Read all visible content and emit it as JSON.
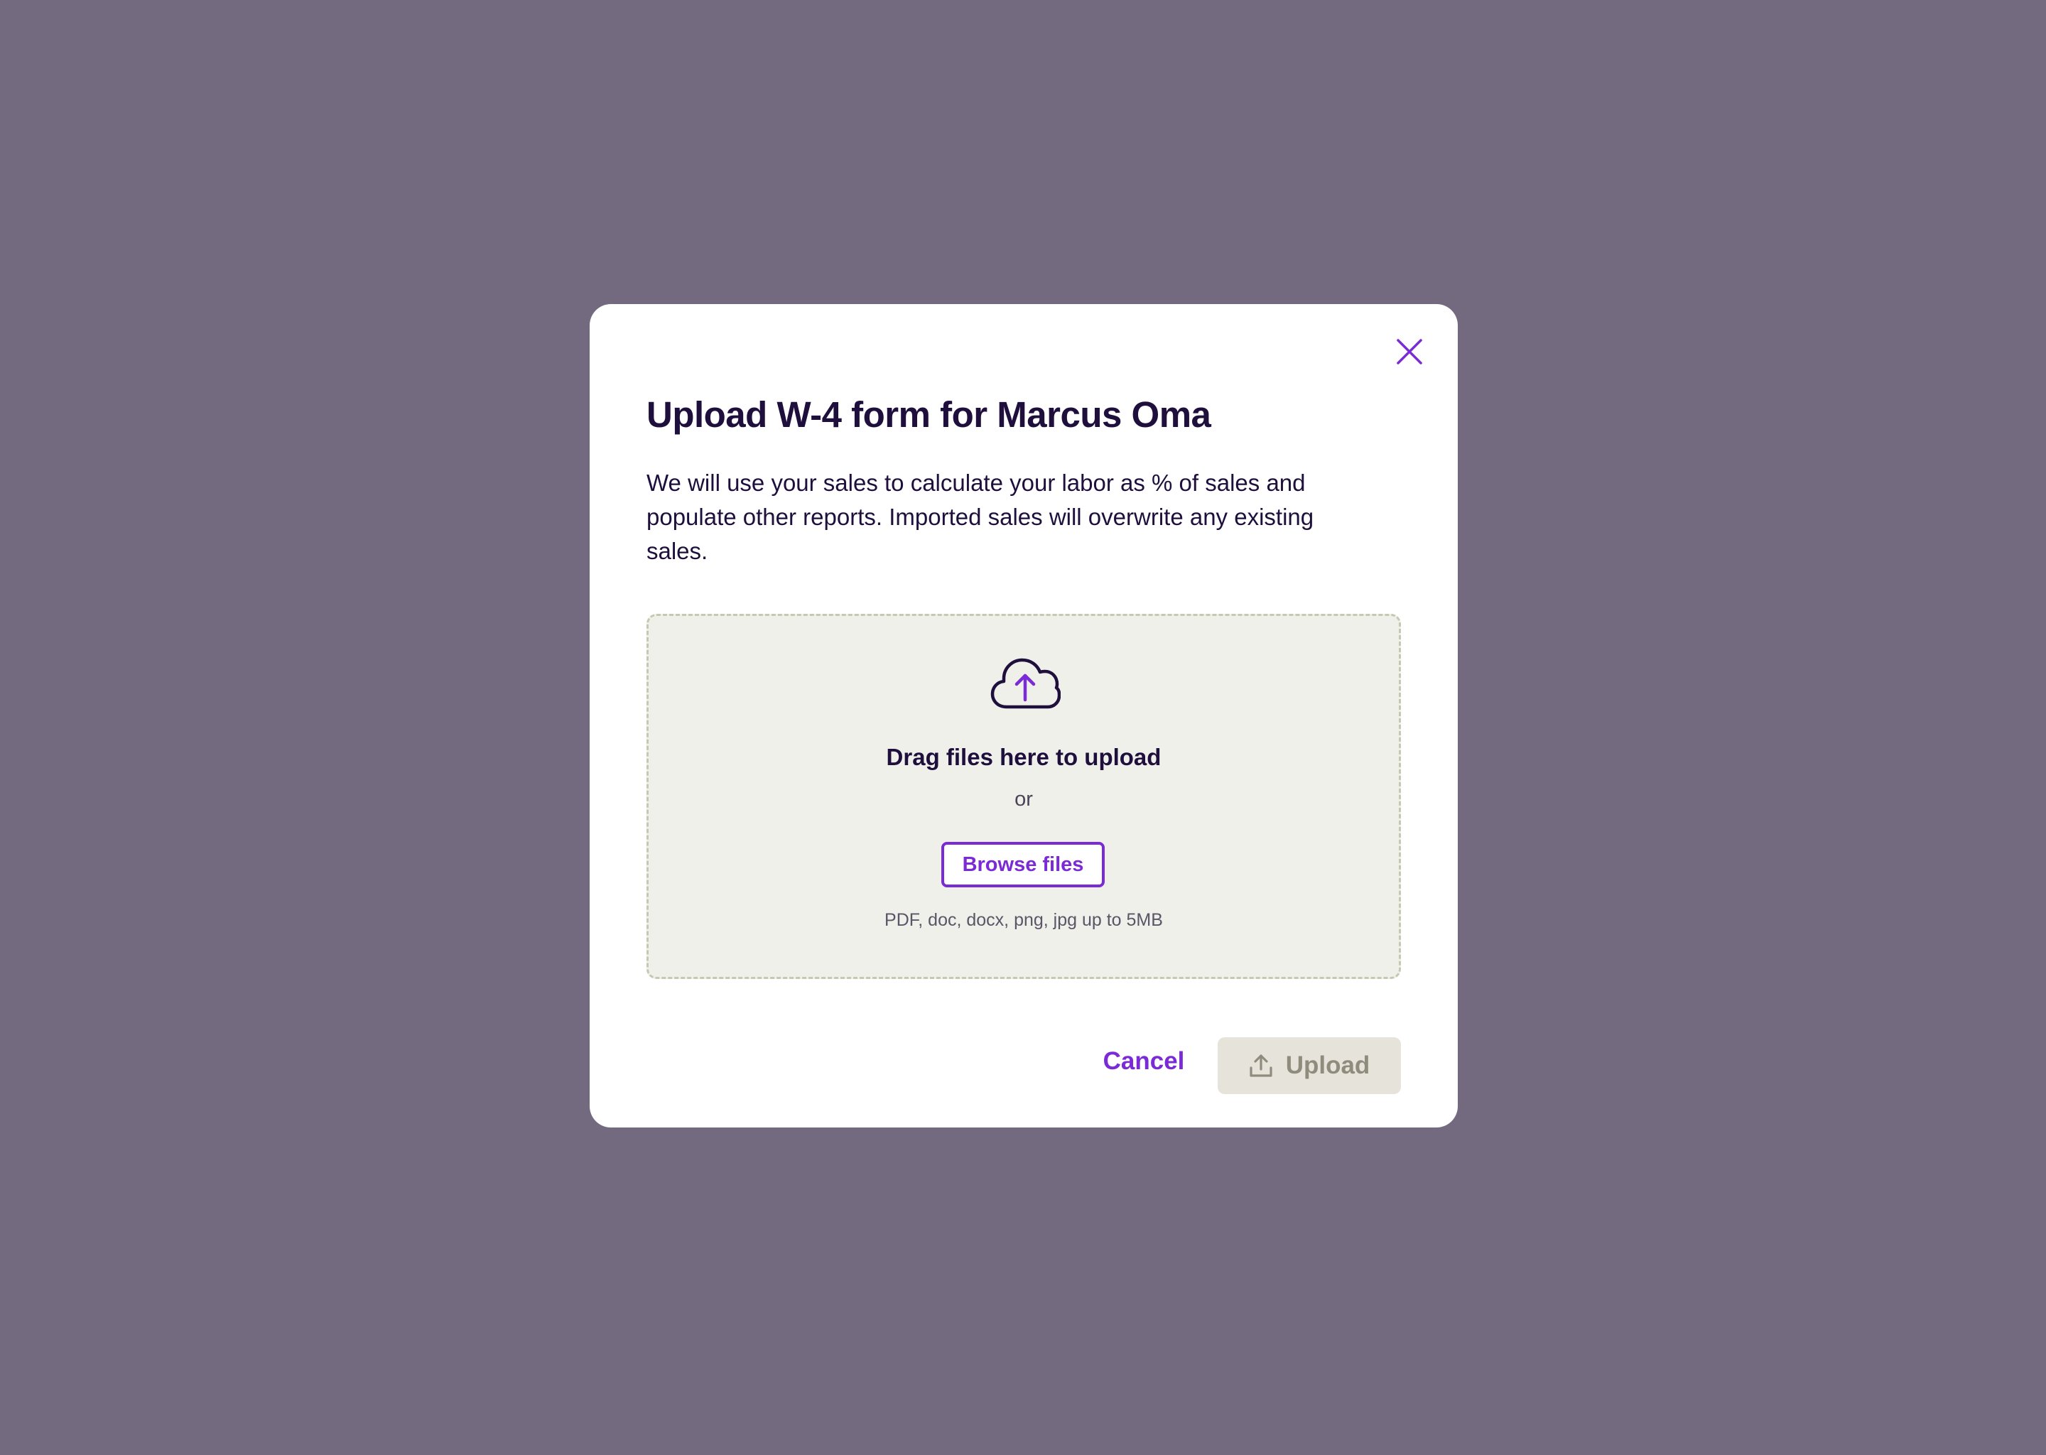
{
  "modal": {
    "title": "Upload W-4 form for Marcus Oma",
    "description": "We will use your sales to calculate your labor as % of sales and populate other reports. Imported sales will overwrite any existing sales.",
    "close_icon": "close-icon"
  },
  "dropzone": {
    "icon": "cloud-upload-icon",
    "drag_text": "Drag files here to upload",
    "or_text": "or",
    "browse_label": "Browse files",
    "hint": "PDF, doc, docx, png, jpg up to 5MB"
  },
  "footer": {
    "cancel_label": "Cancel",
    "upload_label": "Upload",
    "upload_icon": "upload-icon"
  },
  "colors": {
    "backdrop": "#736A80",
    "accent": "#7B2BD6",
    "text_primary": "#1E0F3C",
    "dropzone_bg": "#F0F0EA",
    "disabled_bg": "#E6E4DA",
    "disabled_text": "#8F8C7E"
  }
}
